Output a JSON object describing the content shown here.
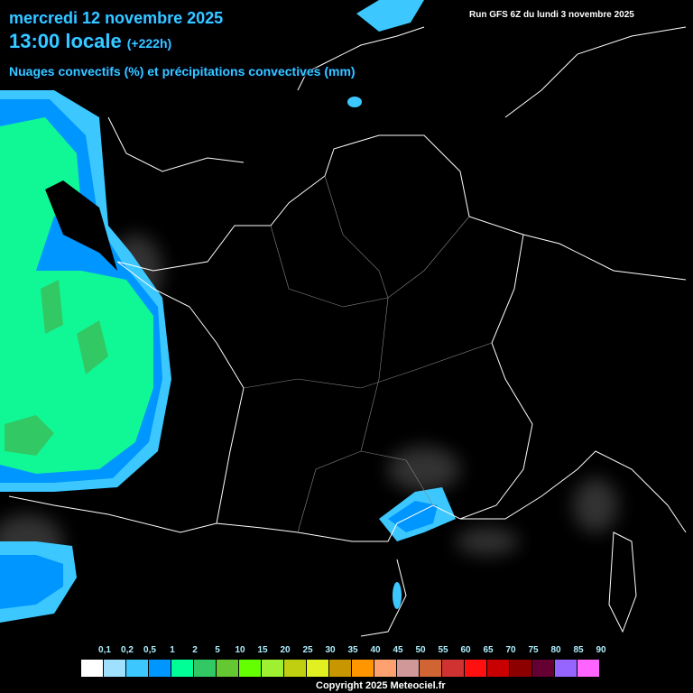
{
  "header": {
    "date": "mercredi 12 novembre 2025",
    "time": "13:00 locale",
    "step": "(+222h)",
    "description": "Nuages convectifs (%) et précipitations convectives (mm)",
    "run": "Run GFS 6Z du lundi 3 novembre 2025"
  },
  "legend": {
    "labels": [
      "0,1",
      "0,2",
      "0,5",
      "1",
      "2",
      "5",
      "10",
      "15",
      "20",
      "25",
      "30",
      "35",
      "40",
      "45",
      "50",
      "55",
      "60",
      "65",
      "70",
      "75",
      "80",
      "85",
      "90"
    ],
    "colors": [
      "#ffffff",
      "#a0e0ff",
      "#3cc8ff",
      "#0096ff",
      "#00ff96",
      "#32c864",
      "#64c832",
      "#64ff00",
      "#a0f032",
      "#c0d010",
      "#e0f020",
      "#c89600",
      "#ff9600",
      "#ffa070",
      "#d09898",
      "#d06432",
      "#d03232",
      "#ff1010",
      "#c80000",
      "#8c0000",
      "#640032",
      "#9664ff",
      "#ff64ff"
    ]
  },
  "footer": {
    "copyright": "Copyright 2025 Meteociel.fr"
  }
}
